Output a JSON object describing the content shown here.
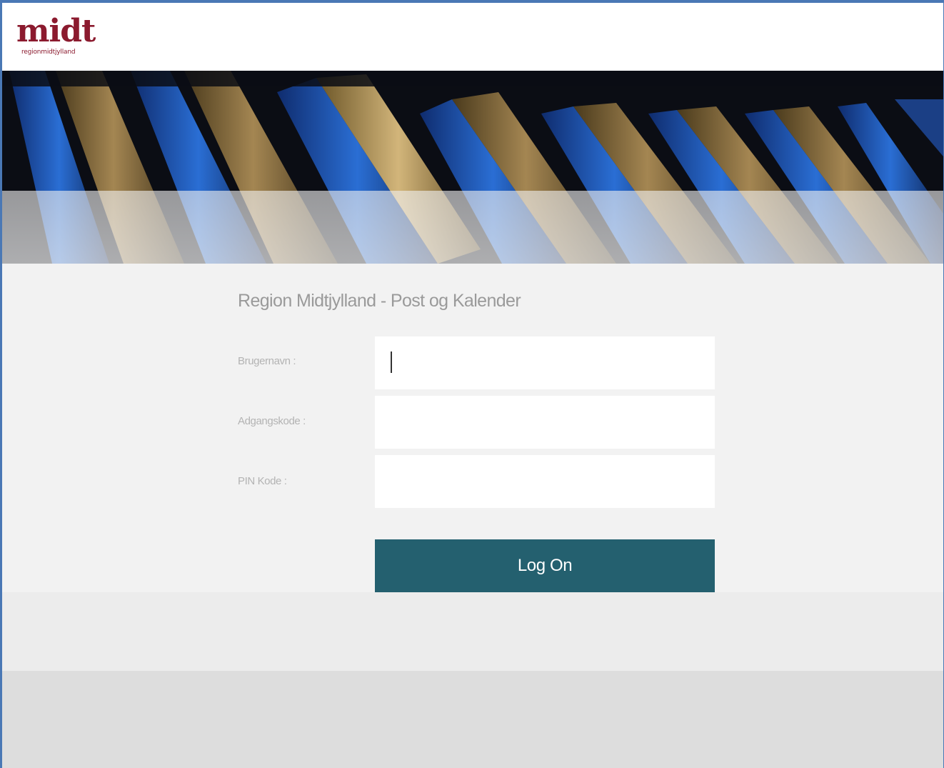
{
  "header": {
    "logo_main": "midt",
    "logo_sub": "regionmidtjylland"
  },
  "login": {
    "title": "Region Midtjylland - Post og Kalender",
    "fields": [
      {
        "label": "Brugernavn :",
        "value": "",
        "type": "text"
      },
      {
        "label": "Adgangskode :",
        "value": "",
        "type": "password"
      },
      {
        "label": "PIN Kode :",
        "value": "",
        "type": "password"
      }
    ],
    "submit_label": "Log On"
  },
  "colors": {
    "logo": "#8b1a2e",
    "button": "#24606f",
    "frame_border": "#4a78b5",
    "form_background": "#f2f2f2"
  },
  "banner": {
    "image_subject": "close-up of blue and gold book spines"
  }
}
